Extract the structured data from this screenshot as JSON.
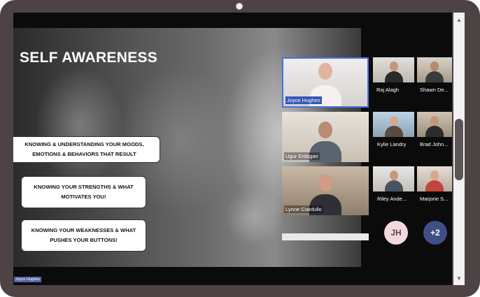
{
  "slide": {
    "title": "SELF AWARENESS",
    "callouts": [
      "KNOWING & UNDERSTANDING YOUR MOODS,\nEMOTIONS & BEHAVIORS THAT RESULT",
      "KNOWING YOUR STRENGTHS & WHAT\nMOTIVATES YOU!",
      "KNOWING YOUR WEAKNESSES & WHAT\nPUSHES YOUR BUTTONS!"
    ]
  },
  "participants": {
    "large": [
      {
        "name": "Joyce Hughes",
        "active": true
      },
      {
        "name": "Ugur Erdogan",
        "active": false
      },
      {
        "name": "Lynne Ciardullo",
        "active": false
      }
    ],
    "small": [
      "Raj Alagh",
      "Shawn De...",
      "Kylie Landry",
      "Brad John...",
      "Riley Ande...",
      "Marjorie S..."
    ],
    "avatars": [
      {
        "label": "JH",
        "bg": "#f3d9de",
        "fg": "#5a4a4d"
      },
      {
        "label": "+2",
        "bg": "#3f4f86",
        "fg": "#ffffff"
      }
    ]
  },
  "presenter_tag": "Joyce Hughes",
  "scrollbar": {
    "up_icon": "▲",
    "down_icon": "▼"
  }
}
